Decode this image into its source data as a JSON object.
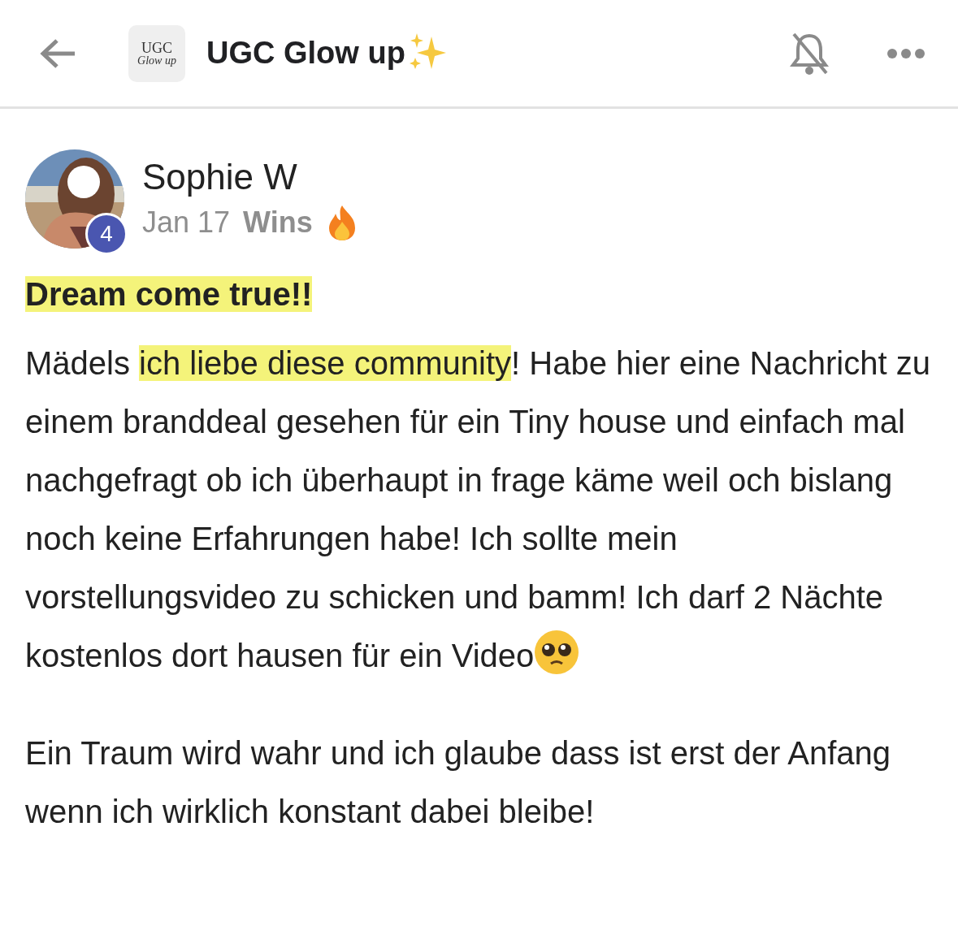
{
  "header": {
    "logo": {
      "line_1": "UGC",
      "line_2": "Glow up"
    },
    "title": "UGC Glow up",
    "title_sparkles": true,
    "notifications_muted": true
  },
  "post": {
    "author": {
      "name": "Sophie W",
      "level": "4"
    },
    "date": "Jan 17",
    "category": "Wins",
    "category_fire": true,
    "title": {
      "text": "Dream come true!!",
      "highlighted": true
    },
    "paragraphs": [
      {
        "segments": [
          {
            "text": "Mädels ",
            "highlighted": false
          },
          {
            "text": "ich liebe diese community",
            "highlighted": true
          },
          {
            "text": "! Habe hier eine Nachricht zu einem branddeal gesehen für ein Tiny house und einfach mal nachgefragt ob ich überhaupt in frage käme weil och bislang noch keine Erfahrungen habe! Ich sollte mein vorstellungsvideo zu schicken und bamm! Ich darf 2 Nächte kostenlos dort hausen für ein Video",
            "highlighted": false
          }
        ],
        "emoji_after": true
      },
      {
        "segments": [
          {
            "text": "Ein Traum wird wahr und ich glaube dass ist erst der Anfang wenn ich wirklich konstant dabei bleibe!",
            "highlighted": false
          }
        ],
        "emoji_after": false
      }
    ]
  }
}
